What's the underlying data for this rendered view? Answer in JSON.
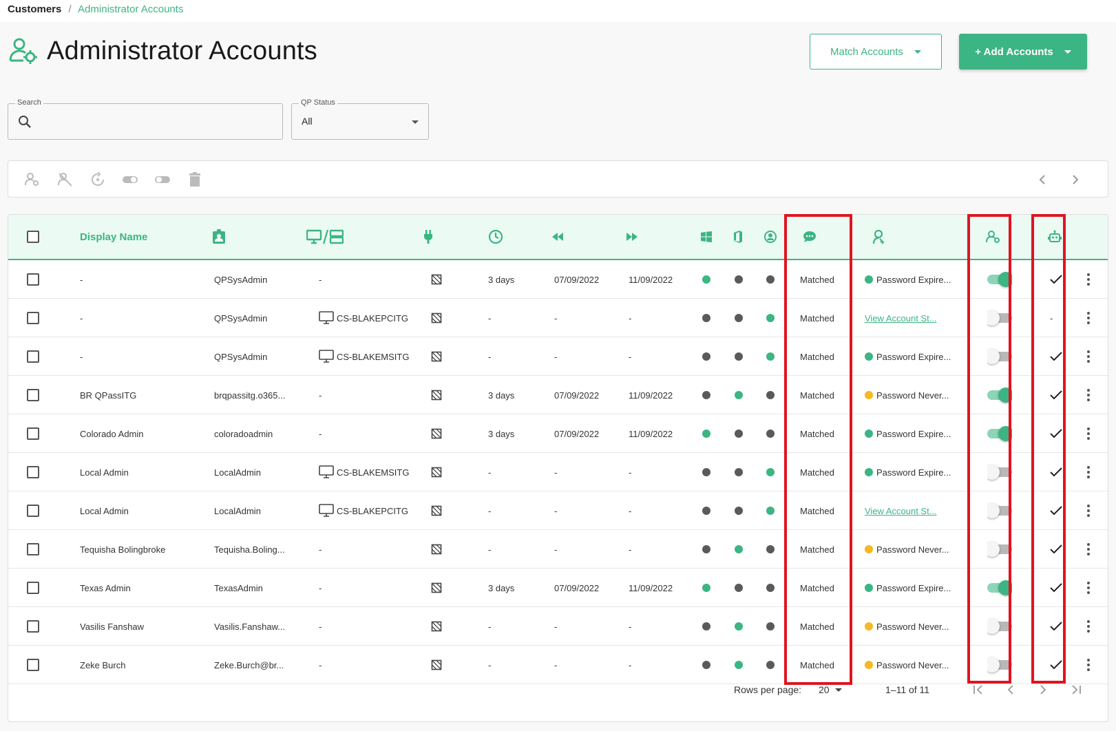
{
  "breadcrumb": {
    "root": "Customers",
    "separator": "/",
    "current": "Administrator Accounts"
  },
  "page": {
    "title": "Administrator Accounts"
  },
  "header_buttons": {
    "match": "Match Accounts",
    "add": "+ Add Accounts"
  },
  "filters": {
    "search": {
      "label": "Search",
      "value": "",
      "placeholder": ""
    },
    "qp_status": {
      "label": "QP Status",
      "value": "All"
    }
  },
  "columns": {
    "display_name": "Display Name"
  },
  "colors": {
    "accent": "#3bb583",
    "green": "#3bb583",
    "gray": "#5a5a5a",
    "yellow": "#f5b922",
    "highlight": "#e0141f"
  },
  "rows": [
    {
      "name": "-",
      "account": "QPSysAdmin",
      "device": "-",
      "device_icon": false,
      "schedule": "3 days",
      "last": "07/09/2022",
      "next": "11/09/2022",
      "d1": "green",
      "d2": "gray",
      "d3": "gray",
      "match": "Matched",
      "status": "Password Expire...",
      "status_type": "green",
      "toggle": true,
      "check": true
    },
    {
      "name": "-",
      "account": "QPSysAdmin",
      "device": "CS-BLAKEPCITG",
      "device_icon": true,
      "schedule": "-",
      "last": "-",
      "next": "-",
      "d1": "gray",
      "d2": "gray",
      "d3": "green",
      "match": "Matched",
      "status": "View Account St...",
      "status_type": "link",
      "toggle": false,
      "check": false,
      "check_text": "-"
    },
    {
      "name": "-",
      "account": "QPSysAdmin",
      "device": "CS-BLAKEMSITG",
      "device_icon": true,
      "schedule": "-",
      "last": "-",
      "next": "-",
      "d1": "gray",
      "d2": "gray",
      "d3": "green",
      "match": "Matched",
      "status": "Password Expire...",
      "status_type": "green",
      "toggle": false,
      "check": true
    },
    {
      "name": "BR QPassITG",
      "account": "brqpassitg.o365...",
      "device": "-",
      "device_icon": false,
      "schedule": "3 days",
      "last": "07/09/2022",
      "next": "11/09/2022",
      "d1": "gray",
      "d2": "green",
      "d3": "gray",
      "match": "Matched",
      "status": "Password Never...",
      "status_type": "yellow",
      "toggle": true,
      "check": true
    },
    {
      "name": "Colorado Admin",
      "account": "coloradoadmin",
      "device": "-",
      "device_icon": false,
      "schedule": "3 days",
      "last": "07/09/2022",
      "next": "11/09/2022",
      "d1": "green",
      "d2": "gray",
      "d3": "gray",
      "match": "Matched",
      "status": "Password Expire...",
      "status_type": "green",
      "toggle": true,
      "check": true
    },
    {
      "name": "Local Admin",
      "account": "LocalAdmin",
      "device": "CS-BLAKEMSITG",
      "device_icon": true,
      "schedule": "-",
      "last": "-",
      "next": "-",
      "d1": "gray",
      "d2": "gray",
      "d3": "green",
      "match": "Matched",
      "status": "Password Expire...",
      "status_type": "green",
      "toggle": false,
      "check": true
    },
    {
      "name": "Local Admin",
      "account": "LocalAdmin",
      "device": "CS-BLAKEPCITG",
      "device_icon": true,
      "schedule": "-",
      "last": "-",
      "next": "-",
      "d1": "gray",
      "d2": "gray",
      "d3": "green",
      "match": "Matched",
      "status": "View Account St...",
      "status_type": "link",
      "toggle": false,
      "check": true
    },
    {
      "name": "Tequisha Bolingbroke",
      "account": "Tequisha.Boling...",
      "device": "-",
      "device_icon": false,
      "schedule": "-",
      "last": "-",
      "next": "-",
      "d1": "gray",
      "d2": "green",
      "d3": "gray",
      "match": "Matched",
      "status": "Password Never...",
      "status_type": "yellow",
      "toggle": false,
      "check": true
    },
    {
      "name": "Texas Admin",
      "account": "TexasAdmin",
      "device": "-",
      "device_icon": false,
      "schedule": "3 days",
      "last": "07/09/2022",
      "next": "11/09/2022",
      "d1": "green",
      "d2": "gray",
      "d3": "gray",
      "match": "Matched",
      "status": "Password Expire...",
      "status_type": "green",
      "toggle": true,
      "check": true
    },
    {
      "name": "Vasilis Fanshaw",
      "account": "Vasilis.Fanshaw...",
      "device": "-",
      "device_icon": false,
      "schedule": "-",
      "last": "-",
      "next": "-",
      "d1": "gray",
      "d2": "green",
      "d3": "gray",
      "match": "Matched",
      "status": "Password Never...",
      "status_type": "yellow",
      "toggle": false,
      "check": true
    },
    {
      "name": "Zeke Burch",
      "account": "Zeke.Burch@br...",
      "device": "-",
      "device_icon": false,
      "schedule": "-",
      "last": "-",
      "next": "-",
      "d1": "gray",
      "d2": "green",
      "d3": "gray",
      "match": "Matched",
      "status": "Password Never...",
      "status_type": "yellow",
      "toggle": false,
      "check": true
    }
  ],
  "pagination": {
    "rows_per_page_label": "Rows per page:",
    "rows_per_page": "20",
    "range": "1–11 of 11"
  }
}
